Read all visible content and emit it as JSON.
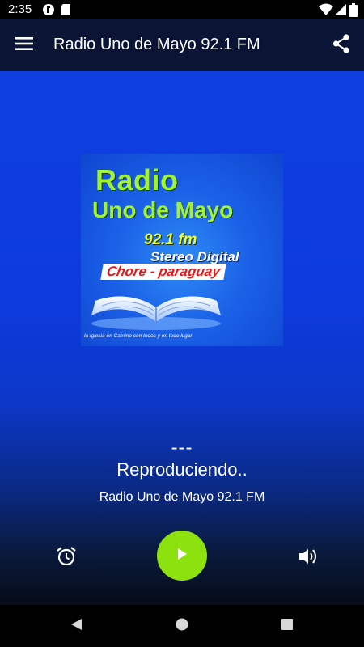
{
  "status_bar": {
    "time": "2:35",
    "icons": [
      "notification-app-icon",
      "sd-card-icon",
      "wifi-icon",
      "signal-icon",
      "battery-icon"
    ]
  },
  "app_bar": {
    "title": "Radio Uno de Mayo 92.1 FM",
    "icons": [
      "hamburger-menu-icon",
      "share-icon"
    ],
    "background": "#0a1434"
  },
  "logo": {
    "line1": "Radio",
    "line2": "Uno de Mayo",
    "frequency": "92.1 fm",
    "stereo": "Stereo Digital",
    "location": "Chore - paraguay",
    "tagline": "la Iglesia en Camino con todos y en todo lugar"
  },
  "now_playing": {
    "track_title": "---",
    "status": "Reproduciendo..",
    "station": "Radio Uno de Mayo 92.1 FM"
  },
  "controls": {
    "icons": [
      "alarm-icon",
      "play-icon",
      "volume-icon"
    ],
    "play_color": "#8de10f"
  },
  "nav_bar": {
    "icons": [
      "back-icon",
      "home-icon",
      "recents-icon"
    ]
  },
  "colors": {
    "main_blue": "#0f3ee0",
    "logo_green": "#9ef23a",
    "location_red": "#e21b1b"
  }
}
